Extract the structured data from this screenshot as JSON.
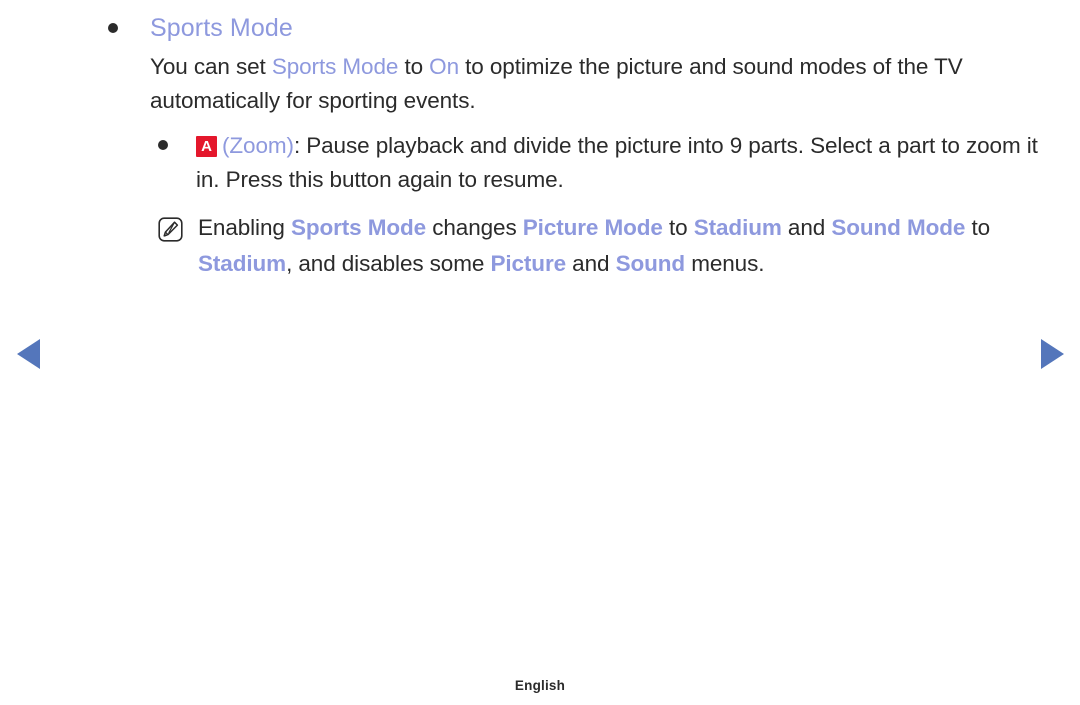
{
  "document": {
    "accent_color": "#8e99de",
    "text_color": "#2b2b2b",
    "badge_color": "#e4172c",
    "arrow_color": "#5476bb",
    "background": "#ffffff"
  },
  "section": {
    "heading": "Sports Mode",
    "body": {
      "seg1": "You can set ",
      "seg2_accent": "Sports Mode",
      "seg3": " to ",
      "seg4_accent": "On",
      "seg5": " to optimize the picture and sound modes of the TV automatically for sporting events."
    }
  },
  "zoom_item": {
    "badge_label": "A",
    "open_paren": "(",
    "label_accent": "Zoom",
    "close_paren": ")",
    "text": ": Pause playback and divide the picture into 9 parts. Select a part to zoom it in. Press this button again to resume."
  },
  "note": {
    "icon_name": "note-pencil-icon",
    "seg1": "Enabling ",
    "seg2_accent": "Sports Mode",
    "seg3": " changes ",
    "seg4_accent": "Picture Mode",
    "seg5": " to ",
    "seg6_accent": "Stadium",
    "seg7": " and ",
    "seg8_accent": "Sound Mode",
    "seg9": " to ",
    "seg10_accent": "Stadium",
    "seg11": ", and disables some ",
    "seg12_accent": "Picture",
    "seg13": " and ",
    "seg14_accent": "Sound",
    "seg15": " menus."
  },
  "navigation": {
    "prev_label": "Previous page",
    "next_label": "Next page"
  },
  "footer": {
    "language": "English"
  }
}
